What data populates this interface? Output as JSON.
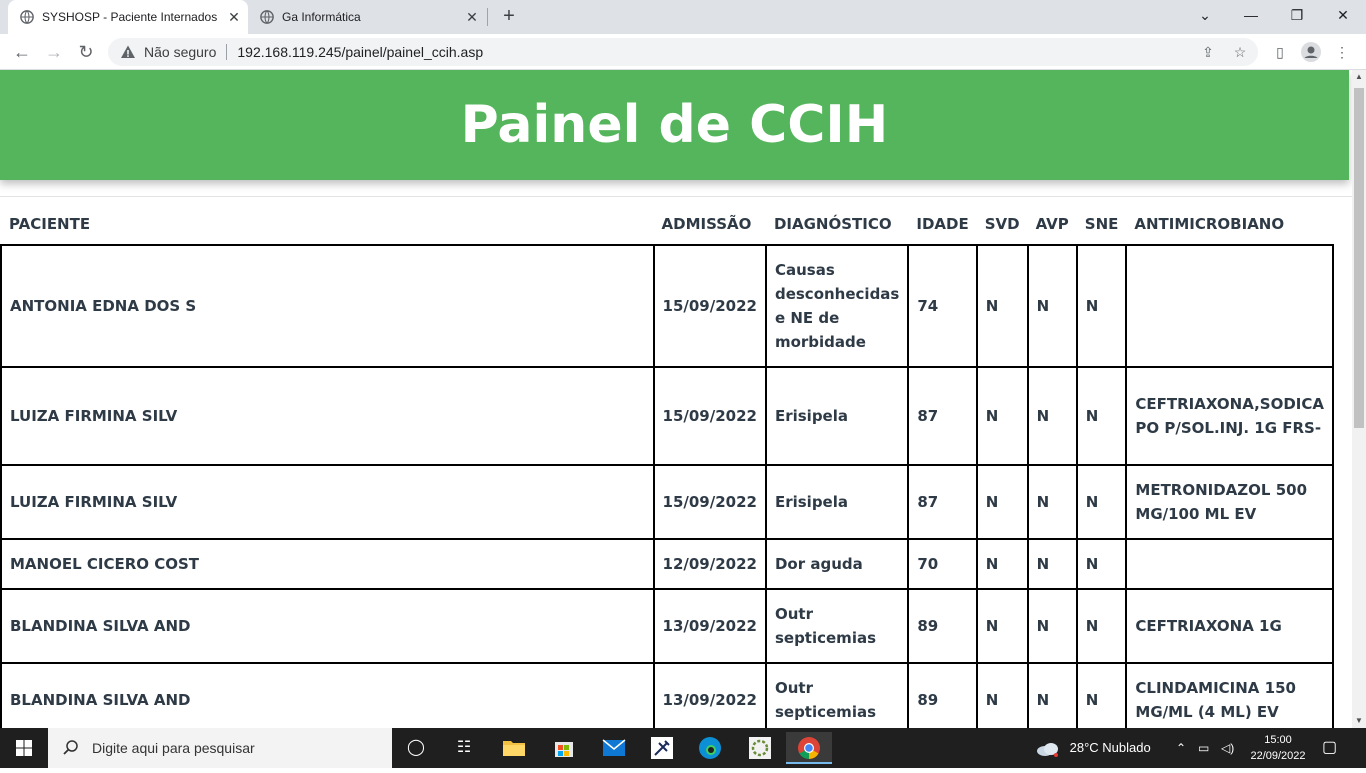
{
  "browser": {
    "tabs": [
      {
        "title": "SYSHOSP - Paciente Internados n",
        "active": true
      },
      {
        "title": "Ga Informática",
        "active": false
      }
    ],
    "new_tab_symbol": "+",
    "security_label": "Não seguro",
    "url": "192.168.119.245/painel/painel_ccih.asp"
  },
  "page": {
    "title": "Painel de CCIH",
    "banner_color": "#55b55c",
    "columns": [
      "PACIENTE",
      "ADMISSÃO",
      "DIAGNÓSTICO",
      "IDADE",
      "SVD",
      "AVP",
      "SNE",
      "ANTIMICROBIANO"
    ],
    "rows": [
      {
        "paciente": "ANTONIA EDNA DOS S",
        "admissao": "15/09/2022",
        "diagnostico": "Causas desconhecidas e NE de morbidade",
        "idade": "74",
        "svd": "N",
        "avp": "N",
        "sne": "N",
        "antimicrobiano": ""
      },
      {
        "paciente": "LUIZA FIRMINA SILV",
        "admissao": "15/09/2022",
        "diagnostico": "Erisipela",
        "idade": "87",
        "svd": "N",
        "avp": "N",
        "sne": "N",
        "antimicrobiano": "CEFTRIAXONA,SODICA PO P/SOL.INJ. 1G FRS-"
      },
      {
        "paciente": "LUIZA FIRMINA SILV",
        "admissao": "15/09/2022",
        "diagnostico": "Erisipela",
        "idade": "87",
        "svd": "N",
        "avp": "N",
        "sne": "N",
        "antimicrobiano": "METRONIDAZOL 500 MG/100 ML EV"
      },
      {
        "paciente": "MANOEL CICERO COST",
        "admissao": "12/09/2022",
        "diagnostico": "Dor aguda",
        "idade": "70",
        "svd": "N",
        "avp": "N",
        "sne": "N",
        "antimicrobiano": ""
      },
      {
        "paciente": "BLANDINA SILVA AND",
        "admissao": "13/09/2022",
        "diagnostico": "Outr septicemias",
        "idade": "89",
        "svd": "N",
        "avp": "N",
        "sne": "N",
        "antimicrobiano": "CEFTRIAXONA 1G"
      },
      {
        "paciente": "BLANDINA SILVA AND",
        "admissao": "13/09/2022",
        "diagnostico": "Outr septicemias",
        "idade": "89",
        "svd": "N",
        "avp": "N",
        "sne": "N",
        "antimicrobiano": "CLINDAMICINA 150 MG/ML (4 ML) EV"
      }
    ]
  },
  "taskbar": {
    "search_placeholder": "Digite aqui para pesquisar",
    "weather": "28°C  Nublado",
    "time": "15:00",
    "date": "22/09/2022",
    "icons": [
      "task-view-icon",
      "widgets-icon",
      "file-explorer-icon",
      "store-icon",
      "mail-icon",
      "syringe-app-icon",
      "edge-icon",
      "app-icon",
      "chrome-icon"
    ]
  }
}
